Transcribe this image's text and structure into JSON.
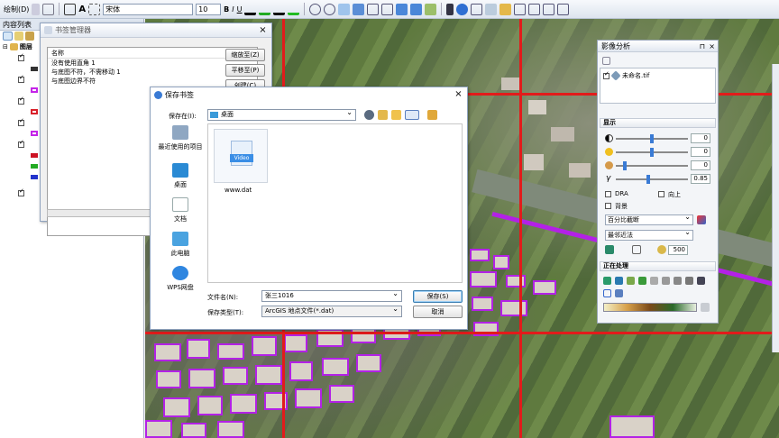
{
  "toolbar": {
    "draw_menu": "绘制(D)",
    "font_name": "宋体",
    "font_size": "10",
    "bold": "B",
    "italic": "I",
    "underline": "U",
    "text_tool": "A"
  },
  "toc": {
    "title": "内容列表",
    "layer_group": "图层"
  },
  "bookmark_manager": {
    "title": "书签管理器",
    "column_header": "名称",
    "items": [
      "没有使用直角 1",
      "与底图不符，不需移动 1",
      "与底图边界不符"
    ],
    "buttons": {
      "zoom_to": "缩放至(Z)",
      "pan_to": "平移至(P)",
      "create": "创建(C)"
    }
  },
  "save_dialog": {
    "title": "保存书签",
    "save_in_label": "保存在(I):",
    "save_in_value": "桌面",
    "places": [
      "最近使用的项目",
      "桌面",
      "文档",
      "此电脑",
      "WPS网盘"
    ],
    "file": {
      "name": "www.dat",
      "type_badge": "Video"
    },
    "filename_label": "文件名(N):",
    "filename_value": "张三1016",
    "filetype_label": "保存类型(T):",
    "filetype_value": "ArcGIS 地点文件(*.dat)",
    "save_button": "保存(S)",
    "cancel_button": "取消"
  },
  "image_analysis": {
    "title": "影像分析",
    "layer": "未命名.tif",
    "display_section": "显示",
    "sliders": [
      {
        "icon": "contrast-icon",
        "value": "0",
        "level": 0.5
      },
      {
        "icon": "brightness-icon",
        "value": "0",
        "level": 0.5
      },
      {
        "icon": "transparency-icon",
        "value": "0",
        "level": 0.1
      },
      {
        "icon": "gamma-icon",
        "label": "γ",
        "value": "0.85",
        "level": 0.45
      }
    ],
    "dra_label": "DRA",
    "on_top_label": "向上",
    "background_label": "背景",
    "stretch": "百分比截断",
    "resample": "最邻近法",
    "zoom_value": "500",
    "processing_section": "正在处理"
  },
  "colors": {
    "grid": "#e21b1b",
    "building_outline": "#b321e6",
    "accent": "#3a7bd5"
  }
}
